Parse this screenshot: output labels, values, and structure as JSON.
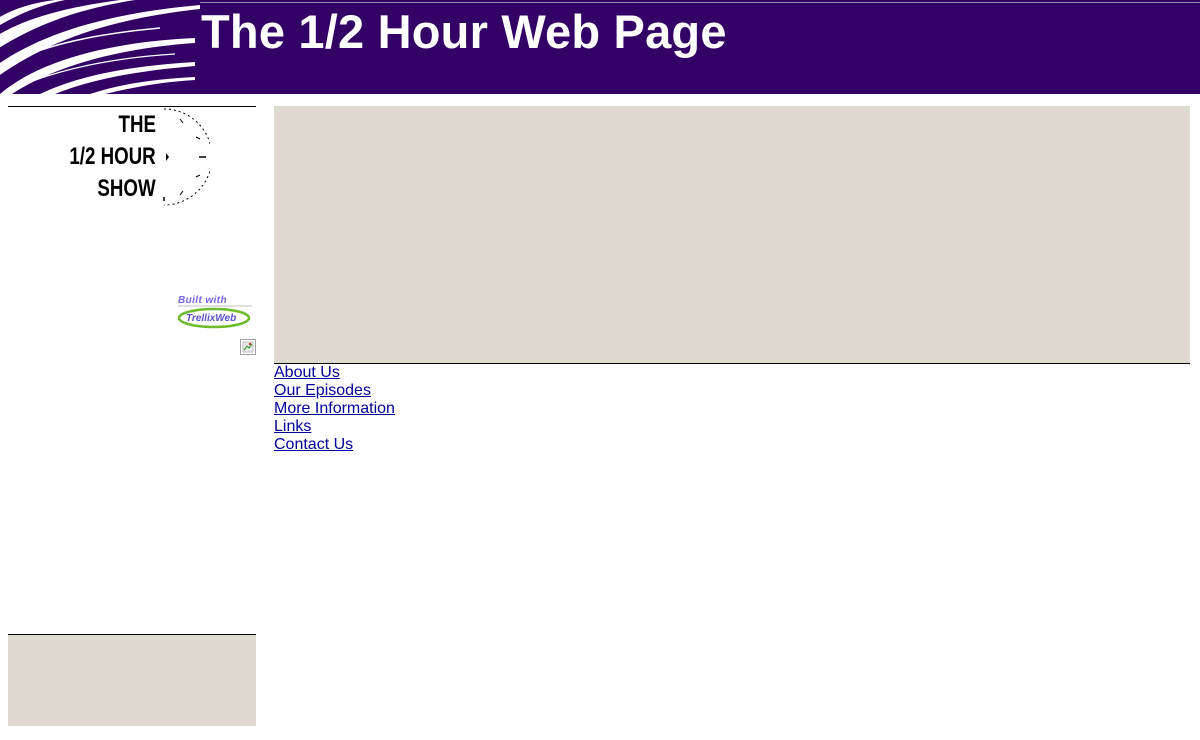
{
  "header": {
    "title": "The 1/2 Hour Web Page",
    "background_color": "#330066"
  },
  "sidebar": {
    "logo": {
      "line1": "THE",
      "line2": "1/2 HOUR",
      "line3": "SHOW"
    },
    "badge": {
      "text": "Built with",
      "logo_text": "TrellixWeb"
    },
    "panel_color": "#dedad0"
  },
  "nav": {
    "items": [
      {
        "label": "About Us"
      },
      {
        "label": "Our Episodes"
      },
      {
        "label": "More Information"
      },
      {
        "label": "Links"
      },
      {
        "label": "Contact Us"
      }
    ],
    "link_color": "#000099"
  },
  "icons": {
    "broken_image": "broken-image-icon",
    "clock": "clock-icon"
  }
}
